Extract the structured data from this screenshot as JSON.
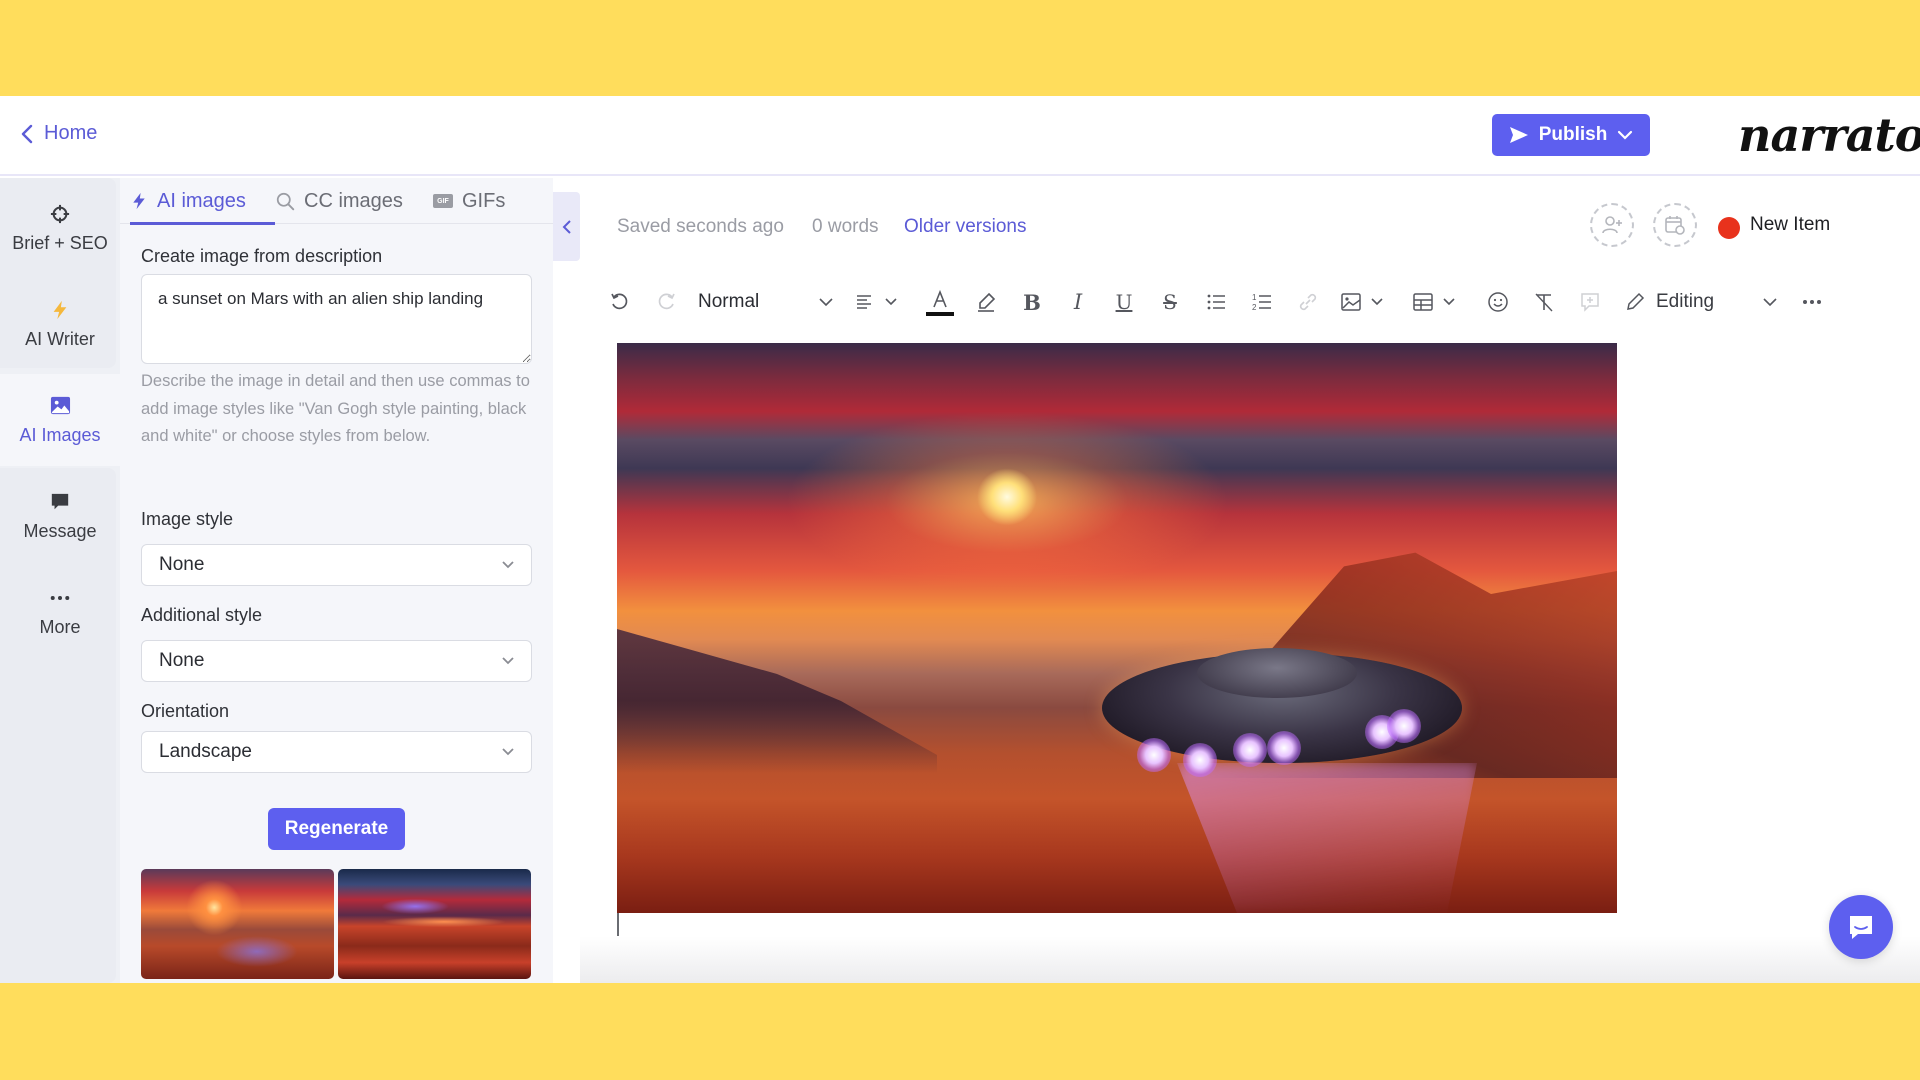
{
  "header": {
    "back_label": "Home",
    "publish_label": "Publish",
    "logo_text": "narrato"
  },
  "sidebar": {
    "items": [
      {
        "label": "Brief + SEO",
        "icon": "crosshair-icon",
        "active": false
      },
      {
        "label": "AI Writer",
        "icon": "lightning-icon",
        "active": false
      },
      {
        "label": "AI Images",
        "icon": "image-icon",
        "active": true
      },
      {
        "label": "Message",
        "icon": "message-icon",
        "active": false
      },
      {
        "label": "More",
        "icon": "more-dots-icon",
        "active": false
      }
    ]
  },
  "panel": {
    "tabs": [
      {
        "label": "AI images",
        "icon": "lightning-icon",
        "active": true
      },
      {
        "label": "CC images",
        "icon": "search-icon",
        "active": false
      },
      {
        "label": "GIFs",
        "icon": "gif-icon",
        "active": false
      }
    ],
    "gif_badge": "GIF",
    "description_label": "Create image from description",
    "description_value": "a sunset on Mars with an alien ship landing",
    "hint": "Describe the image in detail and then use commas to add image styles like \"Van Gogh style painting, black and white\" or choose styles from below.",
    "image_style_label": "Image style",
    "image_style_value": "None",
    "additional_style_label": "Additional style",
    "additional_style_value": "None",
    "orientation_label": "Orientation",
    "orientation_value": "Landscape",
    "regenerate_label": "Regenerate",
    "thumbnails": [
      {
        "alt": "Mars sunset with landing saucer"
      },
      {
        "alt": "Mars dunes with alien ship in sky"
      }
    ]
  },
  "editor": {
    "saved_status": "Saved seconds ago",
    "word_count": "0 words",
    "older_versions_label": "Older versions",
    "item_status": "New Item",
    "item_status_color": "#E8321C",
    "toolbar": {
      "paragraph_style": "Normal",
      "mode": "Editing"
    },
    "image_alt": "a sunset on Mars with an alien ship landing"
  },
  "colors": {
    "accent": "#5D5FEF",
    "link": "#5B5BD6",
    "frame": "#FFDD5C"
  }
}
